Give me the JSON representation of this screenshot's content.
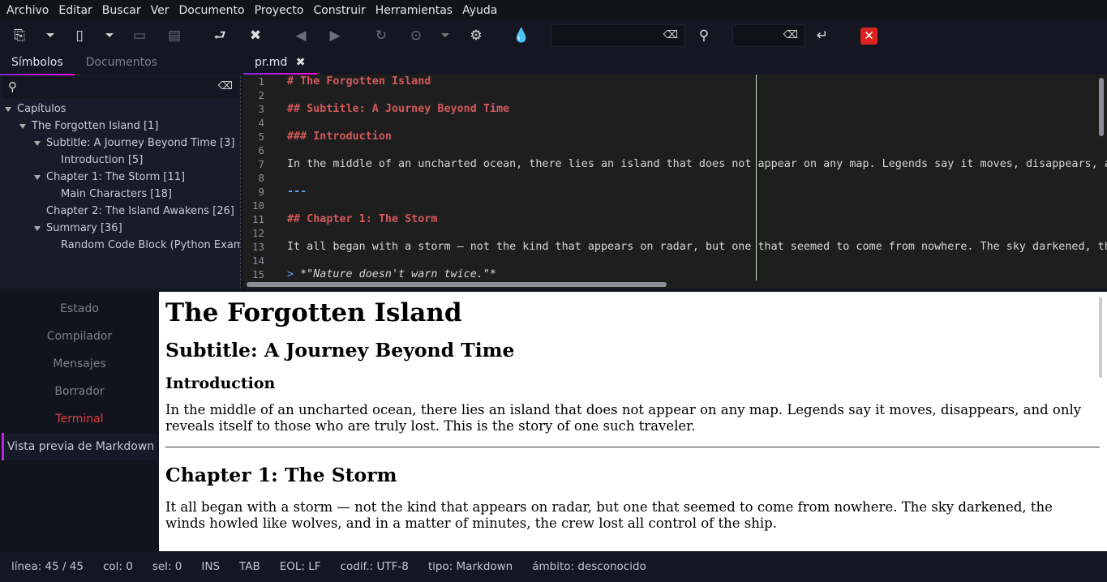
{
  "menu": [
    "Archivo",
    "Editar",
    "Buscar",
    "Ver",
    "Documento",
    "Proyecto",
    "Construir",
    "Herramientas",
    "Ayuda"
  ],
  "toolbar": {
    "icons": [
      "new-file-icon",
      "open-file-icon",
      "save-icon",
      "save-all-icon",
      "revert-icon",
      "close-icon",
      "back-icon",
      "forward-icon",
      "reload-icon",
      "run-icon",
      "preferences-icon",
      "color-picker-icon",
      "search-icon",
      "goto-line-icon",
      "quit-icon"
    ],
    "search_value": "",
    "goto_value": ""
  },
  "sidebar": {
    "tabs": [
      "Símbolos",
      "Documentos"
    ],
    "search_value": "",
    "tree": [
      {
        "label": "Capítulos",
        "level": 0,
        "expanded": true
      },
      {
        "label": "The Forgotten Island [1]",
        "level": 1,
        "expanded": true
      },
      {
        "label": "Subtitle: A Journey Beyond Time [3]",
        "level": 2,
        "expanded": true
      },
      {
        "label": "Introduction [5]",
        "level": 3
      },
      {
        "label": "Chapter 1: The Storm [11]",
        "level": 2,
        "expanded": true
      },
      {
        "label": "Main Characters [18]",
        "level": 3
      },
      {
        "label": "Chapter 2: The Island Awakens [26]",
        "level": 2
      },
      {
        "label": "Summary [36]",
        "level": 2,
        "expanded": true
      },
      {
        "label": "Random Code Block (Python Example)",
        "level": 3
      }
    ]
  },
  "editor": {
    "tab": "pr.md",
    "lines": [
      {
        "n": "1",
        "t": "# The Forgotten Island",
        "k": "hd"
      },
      {
        "n": "2",
        "t": "",
        "k": ""
      },
      {
        "n": "3",
        "t": "## Subtitle: A Journey Beyond Time",
        "k": "hd"
      },
      {
        "n": "4",
        "t": "",
        "k": ""
      },
      {
        "n": "5",
        "t": "### Introduction",
        "k": "hd"
      },
      {
        "n": "6",
        "t": "",
        "k": ""
      },
      {
        "n": "7",
        "t": "In the middle of an uncharted ocean, there lies an island that does not appear on any map. Legends say it moves, disappears, and only reveals itself to those who are truly lost.",
        "k": ""
      },
      {
        "n": "8",
        "t": "",
        "k": ""
      },
      {
        "n": "9",
        "t": "---",
        "k": "hr"
      },
      {
        "n": "10",
        "t": "",
        "k": ""
      },
      {
        "n": "11",
        "t": "## Chapter 1: The Storm",
        "k": "hd"
      },
      {
        "n": "12",
        "t": "",
        "k": ""
      },
      {
        "n": "13",
        "t": "It all began with a storm — not the kind that appears on radar, but one that seemed to come from nowhere. The sky darkened, the winds howled like wolves.",
        "k": ""
      },
      {
        "n": "14",
        "t": "",
        "k": ""
      },
      {
        "n": "15",
        "t": "*\"Nature doesn't warn twice.\"*",
        "k": "quote",
        "prefix": "> "
      }
    ]
  },
  "messages": {
    "tabs": [
      "Estado",
      "Compilador",
      "Mensajes",
      "Borrador",
      "Terminal",
      "Vista previa de Markdown"
    ],
    "active": "Vista previa de Markdown"
  },
  "preview": {
    "h1": "The Forgotten Island",
    "h2": "Subtitle: A Journey Beyond Time",
    "h3": "Introduction",
    "p1": "In the middle of an uncharted ocean, there lies an island that does not appear on any map. Legends say it moves, disappears, and only reveals itself to those who are truly lost. This is the story of one such traveler.",
    "h2b": "Chapter 1: The Storm",
    "p2": "It all began with a storm — not the kind that appears on radar, but one that seemed to come from nowhere. The sky darkened, the winds howled like wolves, and in a matter of minutes, the crew lost all control of the ship."
  },
  "status": {
    "line": "línea: 45 / 45",
    "col": "col: 0",
    "sel": "sel: 0",
    "mode": "INS",
    "indent": "TAB",
    "eol": "EOL: LF",
    "enc": "codif.: UTF-8",
    "type": "tipo: Markdown",
    "scope": "ámbito: desconocido"
  },
  "colors": {
    "accent": "#c020e0",
    "heading": "#d3595b",
    "hr": "#58a6ff",
    "terminal": "#e23b3b"
  }
}
